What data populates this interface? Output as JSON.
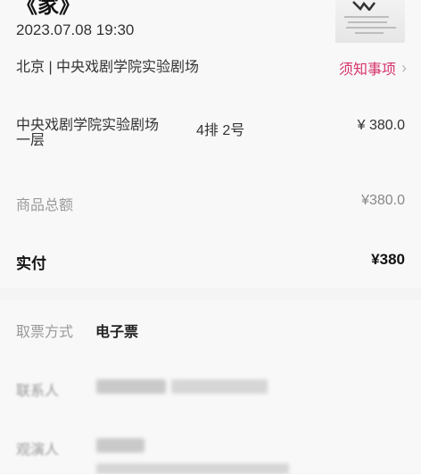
{
  "show": {
    "title_partial": "《家》",
    "datetime": "2023.07.08 19:30",
    "venue_line": "北京 | 中央戏剧学院实验剧场",
    "notice_label": "须知事项",
    "notice_chevron": "›"
  },
  "ticket": {
    "venue": "中央戏剧学院实验剧场 一层",
    "seat": "4排 2号",
    "price": "¥ 380.0"
  },
  "summary": {
    "goods_label": "商品总额",
    "goods_value": "¥380.0",
    "paid_label": "实付",
    "paid_value": "¥380"
  },
  "delivery": {
    "method_label": "取票方式",
    "method_value": "电子票",
    "contact_label": "联系人",
    "viewer_label": "观演人"
  },
  "colors": {
    "accent": "#d6336c",
    "background": "#f4f4f4",
    "card": "#f8f8f8"
  }
}
